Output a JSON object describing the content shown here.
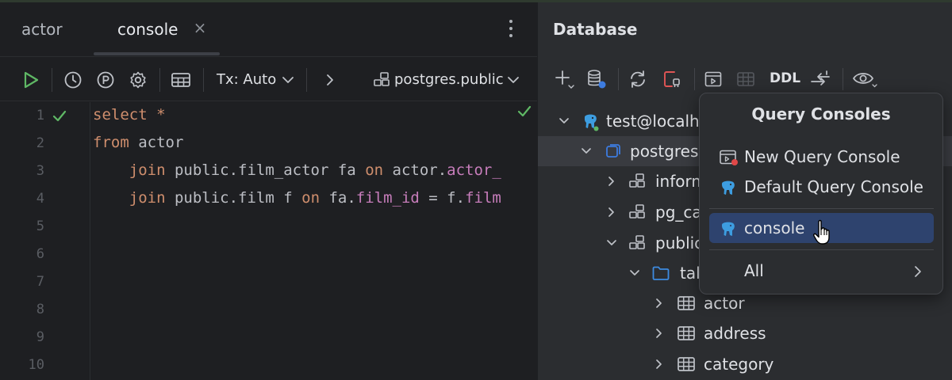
{
  "editor": {
    "tabs": [
      {
        "label": "actor",
        "active": false
      },
      {
        "label": "console",
        "active": true
      }
    ],
    "toolbar": {
      "tx_label": "Tx: Auto",
      "schema_label": "postgres.public"
    },
    "line_numbers": [
      "1",
      "2",
      "3",
      "4",
      "5",
      "6",
      "7",
      "8",
      "9",
      "10"
    ],
    "code": [
      {
        "kw": "select",
        "rest": " *"
      },
      {
        "kw": "from",
        "rest": " actor"
      },
      {
        "indent": "    ",
        "kw": "join",
        "mid": " public.film_actor fa ",
        "kw2": "on",
        "mid2": " actor.",
        "fld": "actor_"
      },
      {
        "indent": "    ",
        "kw": "join",
        "mid": " public.film f ",
        "kw2": "on",
        "mid2": " fa.",
        "fld": "film_id",
        "mid3": " = f.",
        "fld2": "film"
      }
    ]
  },
  "database": {
    "title": "Database",
    "toolbar": {
      "ddl_label": "DDL"
    },
    "tree": [
      {
        "label": "test@localh",
        "icon": "postgres-elephant-icon",
        "expanded": true
      },
      {
        "label": "postgres",
        "icon": "database-icon",
        "expanded": true,
        "selected": true
      },
      {
        "label": "inform",
        "icon": "schema-icon",
        "expanded": false
      },
      {
        "label": "pg_ca",
        "icon": "schema-icon",
        "expanded": false
      },
      {
        "label": "public",
        "icon": "schema-icon",
        "expanded": true
      },
      {
        "label": "tal",
        "icon": "folder-icon",
        "expanded": true
      },
      {
        "label": "actor",
        "icon": "table-icon",
        "expanded": false
      },
      {
        "label": "address",
        "icon": "table-icon",
        "expanded": false
      },
      {
        "label": "category",
        "icon": "table-icon",
        "expanded": false
      }
    ]
  },
  "popup": {
    "title": "Query Consoles",
    "items": [
      {
        "label": "New Query Console",
        "icon": "new-console-icon"
      },
      {
        "label": "Default Query Console",
        "icon": "postgres-elephant-icon"
      },
      {
        "label": "console",
        "icon": "postgres-elephant-icon",
        "highlighted": true
      },
      {
        "label": "All",
        "icon": "",
        "submenu": true
      }
    ]
  },
  "colors": {
    "run_green": "#5fb865",
    "keyword": "#cf8e6d",
    "field": "#c77dbb",
    "selection": "#2e436e",
    "elephant_blue": "#3d9de0"
  }
}
